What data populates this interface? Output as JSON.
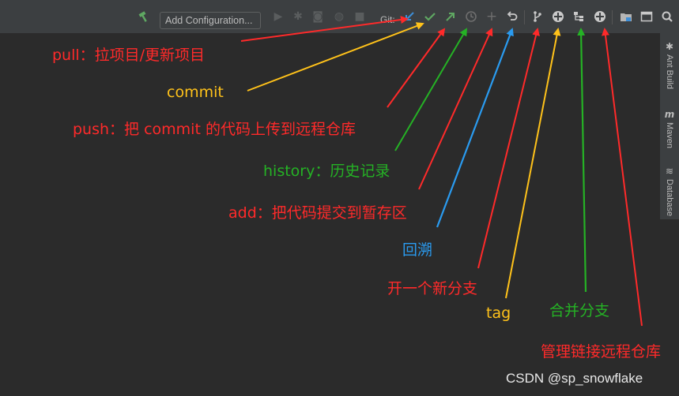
{
  "toolbar": {
    "config_label": "Add Configuration...",
    "vcs_label": "Git:",
    "icons": {
      "build": "hammer-icon",
      "run": "run-icon",
      "debug": "debug-icon",
      "coverage": "coverage-icon",
      "profile": "profile-icon",
      "stop": "stop-icon",
      "update": "vcs-update-icon",
      "commit": "vcs-commit-icon",
      "push": "vcs-push-icon",
      "history": "vcs-history-icon",
      "add": "vcs-add-icon",
      "rollback": "vcs-rollback-icon",
      "branch": "branch-icon",
      "tag": "tag-icon",
      "merge": "merge-icon",
      "remotes": "remotes-icon",
      "project_structure": "project-structure-icon",
      "window": "window-icon",
      "search": "search-icon"
    }
  },
  "side_panel": {
    "items": [
      {
        "label": "Ant Build",
        "icon": "ant-icon"
      },
      {
        "label": "Maven",
        "icon": "maven-icon"
      },
      {
        "label": "Database",
        "icon": "database-icon"
      }
    ]
  },
  "annotations": {
    "pull": "pull：拉项目/更新项目",
    "commit": "commit",
    "push": "push：把 commit 的代码上传到远程仓库",
    "history": "history：历史记录",
    "add": "add：把代码提交到暂存区",
    "rollback": "回溯",
    "branch": "开一个新分支",
    "tag": "tag",
    "merge": "合并分支",
    "remote": "管理链接远程仓库"
  },
  "colors": {
    "red": "#ff2a2a",
    "yellow": "#ffc21a",
    "green": "#25b225",
    "blue": "#2a9bf0",
    "editor_bg": "#2b2b2b",
    "toolbar_bg": "#3c3f41"
  },
  "watermark": "CSDN @sp_snowflake"
}
